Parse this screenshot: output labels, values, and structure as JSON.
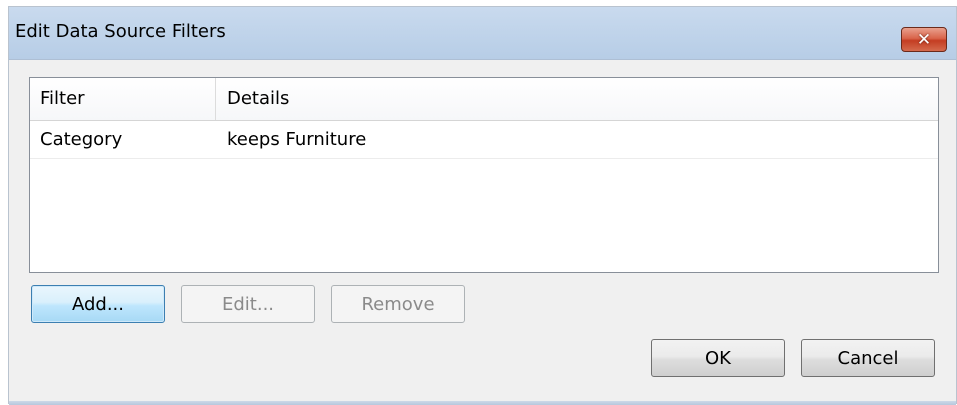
{
  "window": {
    "title": "Edit Data Source Filters",
    "close_glyph": "✕"
  },
  "table": {
    "columns": [
      "Filter",
      "Details"
    ],
    "rows": [
      {
        "filter": "Category",
        "details": "keeps Furniture"
      }
    ]
  },
  "buttons": {
    "add": "Add...",
    "edit": "Edit...",
    "remove": "Remove",
    "ok": "OK",
    "cancel": "Cancel"
  },
  "icons": {
    "close": "close-icon"
  },
  "colors": {
    "titlebar": "#c4d7ed",
    "close_button": "#c94a2e",
    "default_button_border": "#3c7fb1"
  }
}
